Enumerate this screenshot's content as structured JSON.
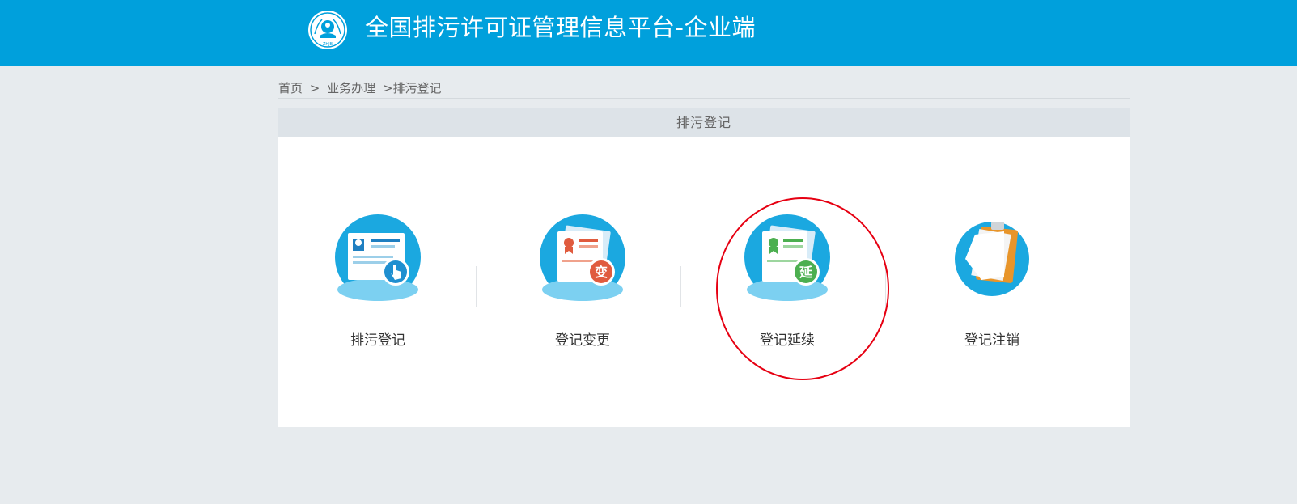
{
  "header": {
    "title": "全国排污许可证管理信息平台-企业端",
    "logo_icon": "ministry-emblem-icon",
    "brand_color": "#00a0dc"
  },
  "breadcrumb": {
    "items": [
      "首页",
      ">",
      "业务办理",
      ">排污登记"
    ]
  },
  "panel": {
    "title": "排污登记",
    "tiles": [
      {
        "label": "排污登记",
        "icon": "registration-card-icon",
        "badge": ""
      },
      {
        "label": "登记变更",
        "icon": "change-certificate-icon",
        "badge": "变"
      },
      {
        "label": "登记延续",
        "icon": "renew-certificate-icon",
        "badge": "延"
      },
      {
        "label": "登记注销",
        "icon": "clipboard-icon",
        "badge": ""
      }
    ]
  },
  "annotation": {
    "highlight_color": "#e60012"
  }
}
